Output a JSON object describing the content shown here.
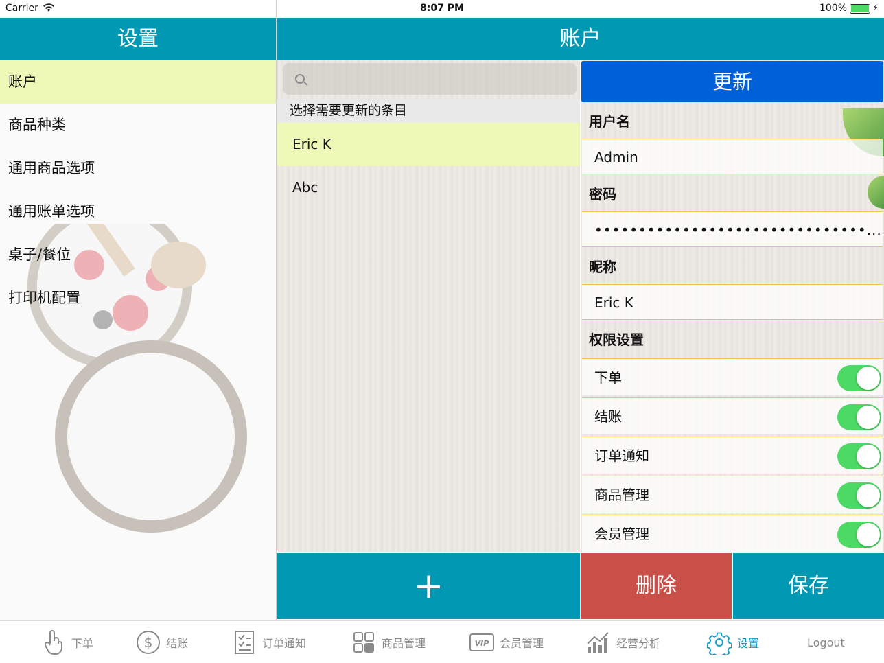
{
  "status_bar": {
    "carrier": "Carrier",
    "time": "8:07 PM",
    "battery": "100%"
  },
  "left": {
    "title": "设置",
    "items": [
      {
        "label": "账户",
        "active": true
      },
      {
        "label": "商品种类"
      },
      {
        "label": "通用商品选项"
      },
      {
        "label": "通用账单选项"
      },
      {
        "label": "桌子/餐位"
      },
      {
        "label": "打印机配置"
      }
    ]
  },
  "main": {
    "title": "账户",
    "section_header": "选择需要更新的条目",
    "list": [
      {
        "label": "Eric K",
        "selected": true
      },
      {
        "label": "Abc"
      }
    ],
    "add_label": "+"
  },
  "detail": {
    "update_label": "更新",
    "username_label": "用户名",
    "username_value": "Admin",
    "password_label": "密码",
    "password_value": "•••••••••••••••••••••••••••••••...",
    "nickname_label": "昵称",
    "nickname_value": "Eric K",
    "permissions_label": "权限设置",
    "permissions": [
      {
        "label": "下单",
        "on": true
      },
      {
        "label": "结账",
        "on": true
      },
      {
        "label": "订单通知",
        "on": true
      },
      {
        "label": "商品管理",
        "on": true
      },
      {
        "label": "会员管理",
        "on": true
      }
    ],
    "delete_label": "删除",
    "save_label": "保存"
  },
  "tabbar": {
    "items": [
      {
        "label": "下单",
        "icon": "hand-pointer-icon"
      },
      {
        "label": "结账",
        "icon": "dollar-circle-icon"
      },
      {
        "label": "订单通知",
        "icon": "checklist-icon"
      },
      {
        "label": "商品管理",
        "icon": "grid-icon"
      },
      {
        "label": "会员管理",
        "icon": "vip-card-icon"
      },
      {
        "label": "经营分析",
        "icon": "chart-icon"
      },
      {
        "label": "设置",
        "icon": "gear-icon",
        "active": true
      },
      {
        "label": "Logout"
      }
    ],
    "active_color": "#0e9bc4"
  },
  "colors": {
    "header": "#0098b2",
    "update": "#0060d8",
    "delete": "#c95048",
    "selected_row": "#eef9b8",
    "toggle_on": "#4cd964"
  }
}
